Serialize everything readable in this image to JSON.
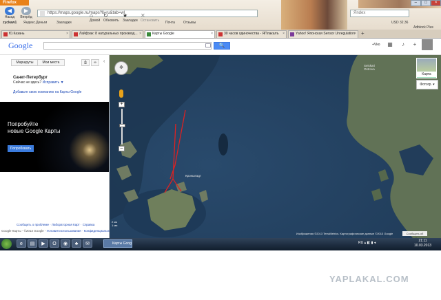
{
  "browser": {
    "menu_label": "Firefox",
    "nav": {
      "back": "Назад",
      "forward": "Вперёд"
    },
    "url": "https://maps.google.ru/maps?ll=ru&tab=wl",
    "search_placeholder": "Яndex",
    "window_controls": [
      "–",
      "□",
      "×"
    ],
    "toolbar": {
      "user": "zyckaw1",
      "yandex_money": "Яндекс.Деньги",
      "bookmarks": "Закладки",
      "home": "Домой",
      "refresh": "Обновить",
      "bookmarks_btn": "Закладки",
      "stop": "Остановить",
      "mail": "Почта",
      "reviews": "Отзывы",
      "weather": "USD 32.36",
      "adblock": "Adblock Plus"
    },
    "tabs": [
      {
        "label": "Ю.Казань",
        "active": false
      },
      {
        "label": "Лайфхак: 8 натуральных производ...",
        "active": false
      },
      {
        "label": "Карты Google",
        "active": true
      },
      {
        "label": "30 часов одиночества - ЯПлакалъ",
        "active": false
      },
      {
        "label": "Yahoo! Японская Sensor Unregulation",
        "active": false
      }
    ]
  },
  "google_bar": {
    "logo": "Google",
    "search_button": "🔍",
    "user": "+Vko",
    "icons": [
      "apps-icon",
      "bell-icon",
      "plus-icon"
    ]
  },
  "left_panel": {
    "btn_routes": "Маршруты",
    "btn_places": "Мои места",
    "location_title": "Санкт-Петербург",
    "location_q": "Сейчас не здесь?",
    "location_fix": "Исправить ▼",
    "add_company": "Добавьте свою компанию на Карты Google",
    "promo_line1": "Попробуйте",
    "promo_line2": "новые Google Карты",
    "promo_button": "Попробовать",
    "footer_links": "Сообщить о проблеме · Лабораторная Карт · Справка",
    "footer_copyright": "Google Карты - ©2013 Google - ",
    "footer_links2": "Условия использования · Конфиденциальность"
  },
  "map": {
    "label_island": "Кронштадт",
    "label_kotlin": "Кронштадт",
    "label_isl2a": "Seiskari",
    "label_isl2b": "Ostrova",
    "attribution": "Изображения ©2013 TerraMetrics. Картографические данные ©2013 Google",
    "feedback": "Сообщить об ошибке",
    "scale_km": "2 км",
    "scale_mi": "1 ми",
    "map_type_label": "Карта",
    "photos_label": "Фотогр. ▾",
    "zoom_in": "+",
    "zoom_out": "–"
  },
  "taskbar": {
    "active_task": "Карты Google",
    "tray_lang": "RU",
    "time": "21:11",
    "date": "10.03.2013"
  },
  "watermark": "YAPLAKAL.COM"
}
